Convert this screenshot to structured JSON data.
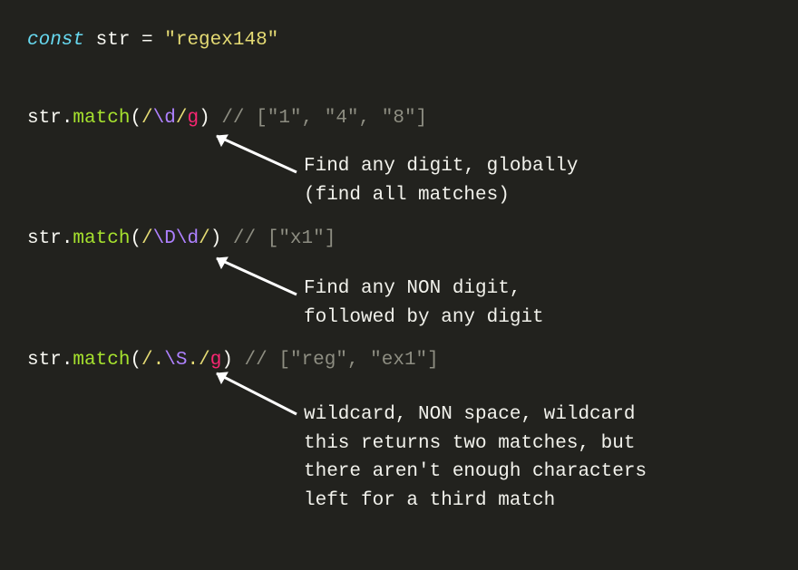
{
  "line1": {
    "const": "const",
    "ident": " str ",
    "eq": "= ",
    "string": "\"regex148\""
  },
  "line2": {
    "ident": "str",
    "dot": ".",
    "method": "match",
    "open": "(",
    "rdelim1": "/",
    "esc": "\\d",
    "rdelim2": "/",
    "flag": "g",
    "close": ")",
    "space": " ",
    "comment": "// [\"1\", \"4\", \"8\"]"
  },
  "note2": "Find any digit, globally\n(find all matches)",
  "line3": {
    "ident": "str",
    "dot": ".",
    "method": "match",
    "open": "(",
    "rdelim1": "/",
    "esc1": "\\D",
    "esc2": "\\d",
    "rdelim2": "/",
    "close": ")",
    "space": " ",
    "comment": "// [\"x1\"]"
  },
  "note3": "Find any NON digit,\nfollowed by any digit",
  "line4": {
    "ident": "str",
    "dot": ".",
    "method": "match",
    "open": "(",
    "rdelim1": "/",
    "body1": ".",
    "esc": "\\S",
    "body2": ".",
    "rdelim2": "/",
    "flag": "g",
    "close": ")",
    "space": " ",
    "comment": "// [\"reg\", \"ex1\"]"
  },
  "note4": "wildcard, NON space, wildcard\nthis returns two matches, but\nthere aren't enough characters\nleft for a third match"
}
